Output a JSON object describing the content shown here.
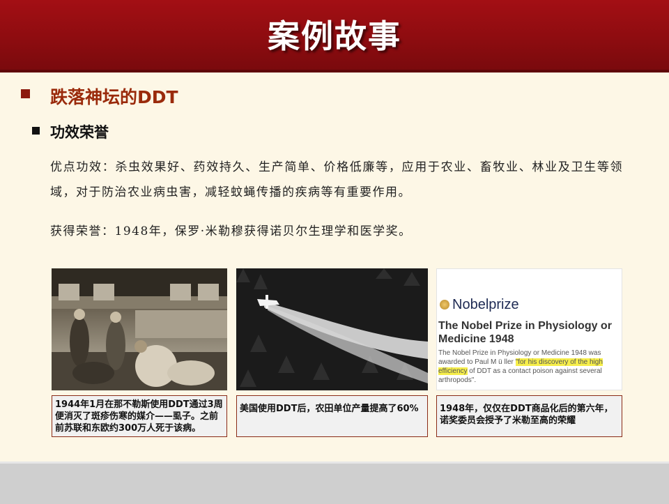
{
  "header": {
    "title": "案例故事"
  },
  "section": {
    "heading1": "跌落神坛的DDT",
    "heading2": "功效荣誉"
  },
  "paragraphs": {
    "p1_lead": "优点功效：",
    "p1_body": "杀虫效果好、药效持久、生产简单、价格低廉等，应用于农业、畜牧业、林业及卫生等领域，对于防治农业病虫害，减轻蚊蝇传播的疾病等有重要作用。",
    "p2_lead": "获得荣誉：",
    "p2_body": "1948年，保罗·米勒穆获得诺贝尔生理学和医学奖。"
  },
  "nobel": {
    "logo": "Nobelprize",
    "title": "The Nobel Prize in Physiology or Medicine 1948",
    "text_a": "The Nobel Prize in Physiology or Medicine 1948 was awarded to Paul M ü ller ",
    "text_hl": "\"for his discovery of the high efficiency",
    "text_b": " of DDT as a contact poison against several arthropods\"."
  },
  "captions": {
    "c1": "1944年1月在那不勒斯使用DDT通过3周便消灭了斑疹伤寒的媒介——虱子。之前前苏联和东欧约300万人死于该病。",
    "c2": "美国使用DDT后，农田单位产量提高了60%",
    "c3": "1948年，仅仅在DDT商品化后的第六年，诺奖委员会授予了米勒至高的荣耀"
  },
  "colors": {
    "header": "#a30f14",
    "accent": "#9a2a0b",
    "background": "#fdf7e6"
  }
}
